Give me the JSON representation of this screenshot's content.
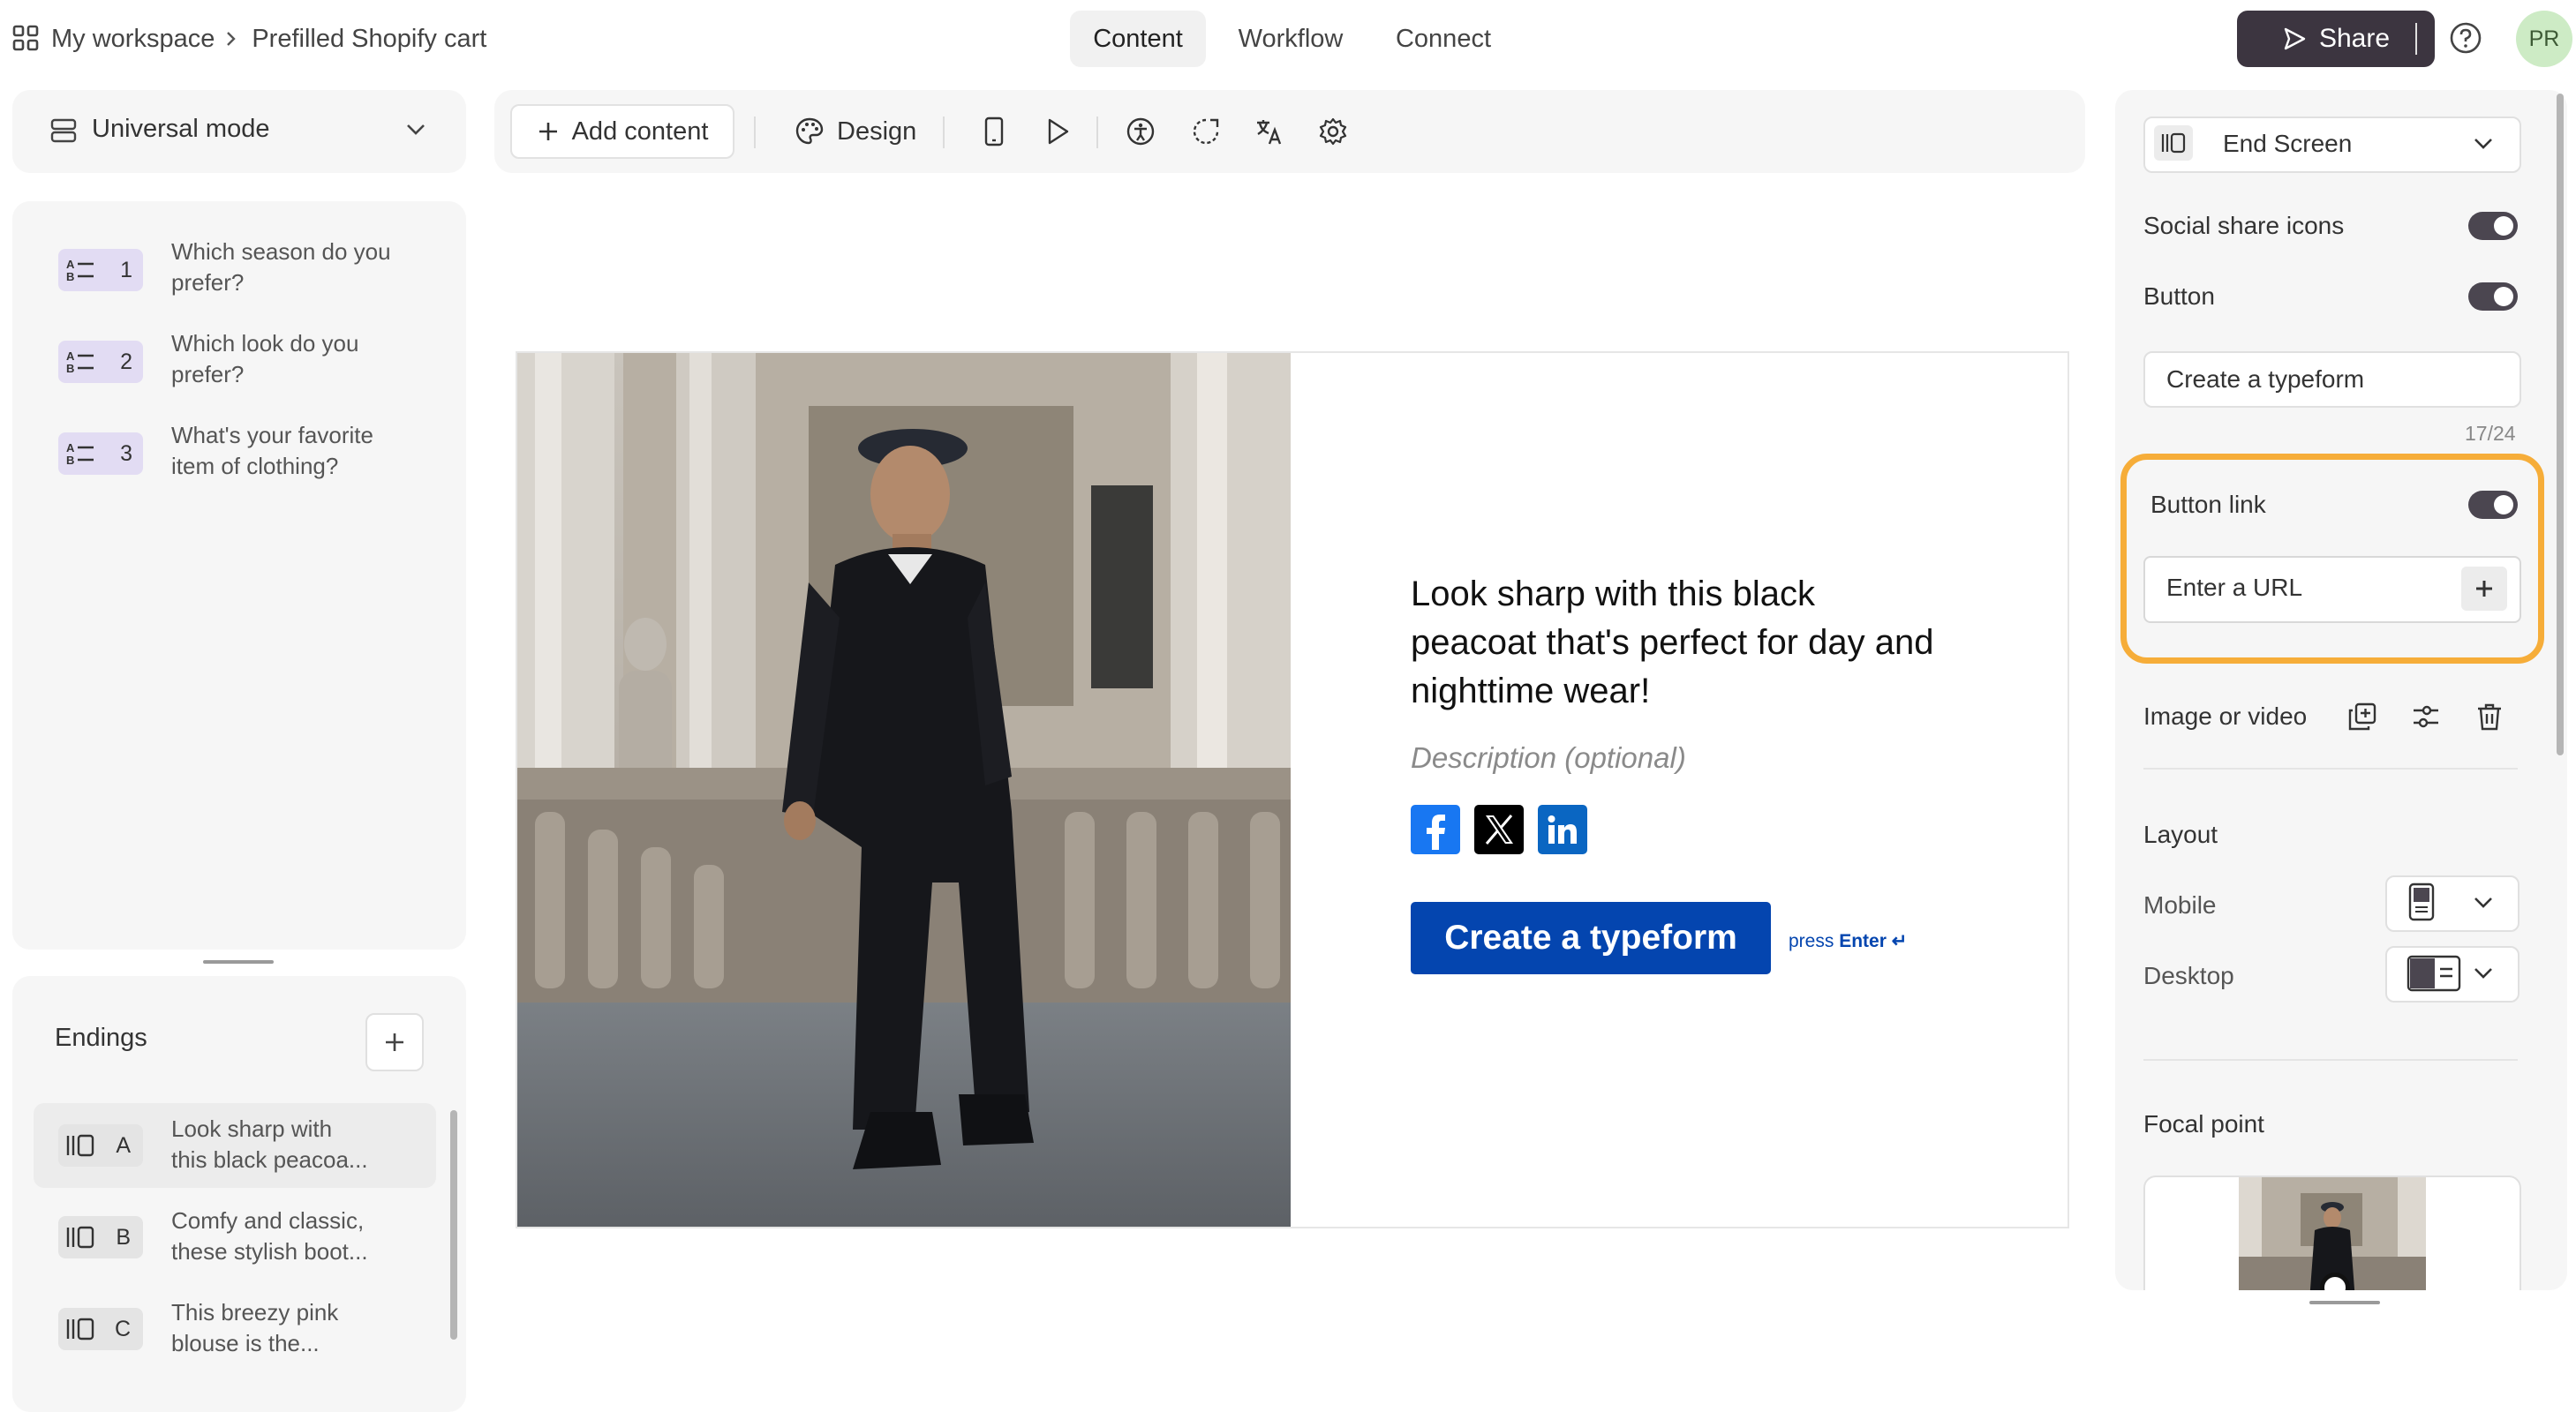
{
  "topbar": {
    "workspace": "My workspace",
    "form_name": "Prefilled Shopify cart",
    "tabs": [
      "Content",
      "Workflow",
      "Connect"
    ],
    "share_label": "Share",
    "avatar_initials": "PR"
  },
  "mode": {
    "label": "Universal mode"
  },
  "questions": [
    {
      "number": "1",
      "line1": "Which season do you",
      "line2": "prefer?"
    },
    {
      "number": "2",
      "line1": "Which look do you",
      "line2": "prefer?"
    },
    {
      "number": "3",
      "line1": "What's your favorite",
      "line2": "item of clothing?"
    }
  ],
  "endings": {
    "title": "Endings",
    "items": [
      {
        "letter": "A",
        "line1": "Look sharp with",
        "line2": "this black peacoa..."
      },
      {
        "letter": "B",
        "line1": "Comfy and classic,",
        "line2": "these stylish boot..."
      },
      {
        "letter": "C",
        "line1": "This breezy pink",
        "line2": "blouse is the..."
      }
    ]
  },
  "toolbar": {
    "add_content": "Add content",
    "design": "Design"
  },
  "canvas": {
    "title_line1": "Look sharp with this black",
    "title_line2": "peacoat that's perfect for day and",
    "title_line3": "nighttime wear!",
    "description": "Description (optional)",
    "cta_label": "Create a typeform",
    "press_text": "press",
    "press_key": "Enter ↵"
  },
  "right_panel": {
    "screen_type": "End Screen",
    "social_share_label": "Social share icons",
    "button_label": "Button",
    "button_text_value": "Create a typeform",
    "char_count": "17/24",
    "button_link_label": "Button link",
    "url_placeholder": "Enter a URL",
    "image_or_video_label": "Image or video",
    "layout_title": "Layout",
    "mobile_label": "Mobile",
    "desktop_label": "Desktop",
    "focal_point_title": "Focal point"
  },
  "colors": {
    "accent_highlight": "#f6ad39",
    "cta_blue": "#0445af",
    "share_button": "#3c3540",
    "badge_question": "#e2dcf3"
  }
}
